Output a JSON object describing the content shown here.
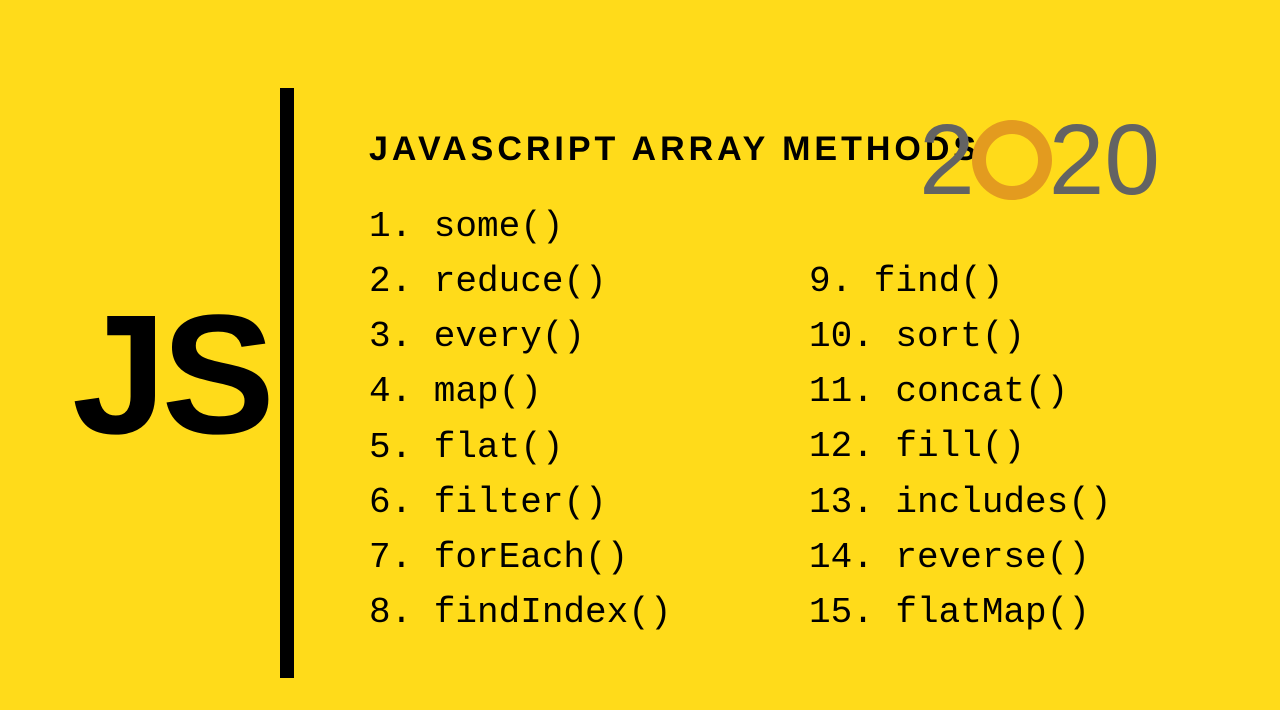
{
  "logo": "JS",
  "title": "JAVASCRIPT ARRAY METHODS",
  "year": {
    "d1": "2",
    "d2": "2",
    "d3": "0"
  },
  "methods_left": [
    "1. some()",
    "2. reduce()",
    "3. every()",
    "4. map()",
    "5. flat()",
    "6. filter()",
    "7. forEach()",
    "8. findIndex()"
  ],
  "methods_right": [
    "9. find()",
    "10. sort()",
    "11. concat()",
    "12. fill()",
    "13. includes()",
    "14. reverse()",
    "15. flatMap()"
  ]
}
